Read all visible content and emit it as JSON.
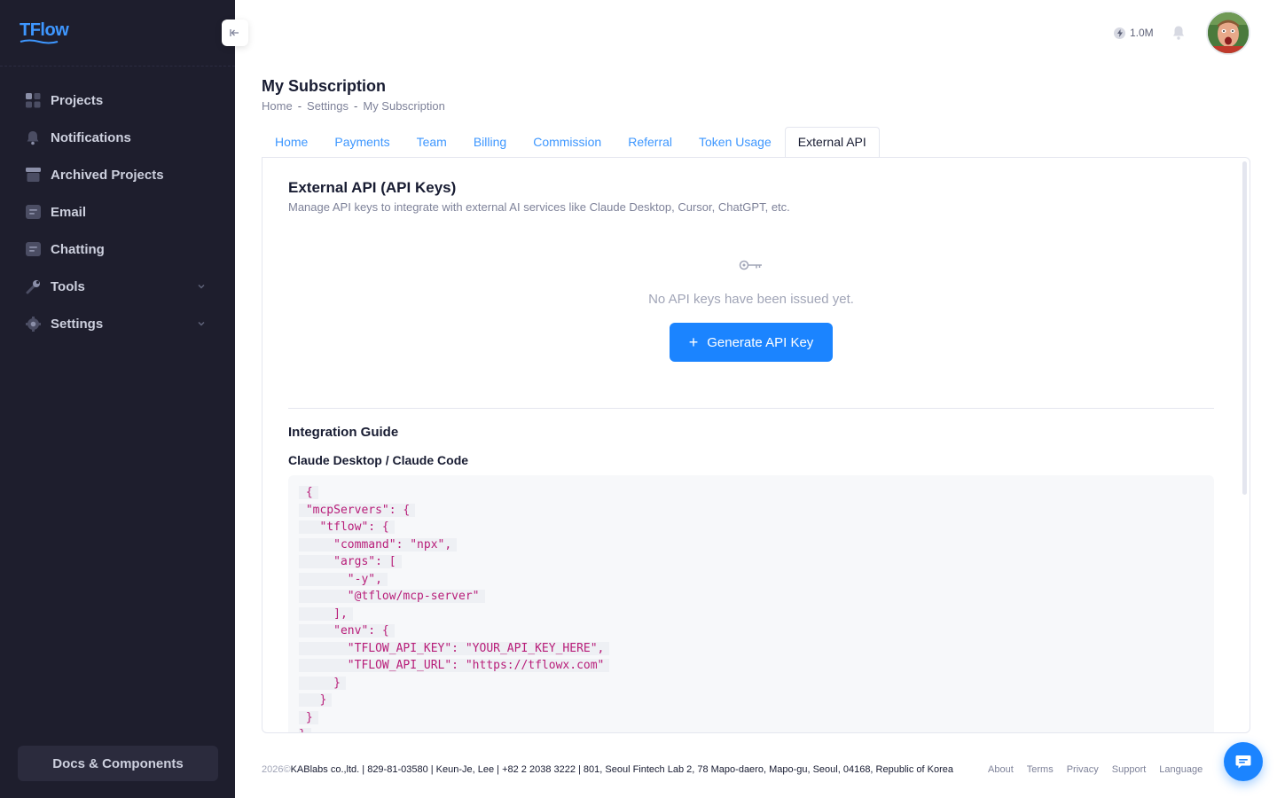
{
  "brand": {
    "name": "TFlow",
    "accent": "#1b84ff"
  },
  "sidebar": {
    "items": [
      {
        "label": "Projects",
        "icon": "grid-icon"
      },
      {
        "label": "Notifications",
        "icon": "bell-icon"
      },
      {
        "label": "Archived Projects",
        "icon": "archive-icon"
      },
      {
        "label": "Email",
        "icon": "message-icon"
      },
      {
        "label": "Chatting",
        "icon": "chat-icon"
      },
      {
        "label": "Tools",
        "icon": "wrench-icon",
        "expandable": true
      },
      {
        "label": "Settings",
        "icon": "gear-icon",
        "expandable": true
      }
    ],
    "docs_label": "Docs & Components"
  },
  "header": {
    "tokens": "1.0M"
  },
  "page": {
    "title": "My Subscription",
    "breadcrumb": [
      "Home",
      "Settings",
      "My Subscription"
    ]
  },
  "tabs": [
    "Home",
    "Payments",
    "Team",
    "Billing",
    "Commission",
    "Referral",
    "Token Usage",
    "External API"
  ],
  "active_tab": "External API",
  "card": {
    "title": "External API (API Keys)",
    "subtitle": "Manage API keys to integrate with external AI services like Claude Desktop, Cursor, ChatGPT, etc.",
    "empty_text": "No API keys have been issued yet.",
    "generate_label": "Generate API Key",
    "guide_title": "Integration Guide",
    "guide_subtitle": "Claude Desktop / Claude Code",
    "code_lines": [
      " {",
      " \"mcpServers\": {",
      "   \"tflow\": {",
      "     \"command\": \"npx\",",
      "     \"args\": [",
      "       \"-y\",",
      "       \"@tflow/mcp-server\"",
      "     ],",
      "     \"env\": {",
      "       \"TFLOW_API_KEY\": \"YOUR_API_KEY_HERE\",",
      "       \"TFLOW_API_URL\": \"https://tflowx.com\"",
      "     }",
      "   }",
      " }",
      "}"
    ]
  },
  "footer": {
    "year": "2026©",
    "company": " KABlabs co.,ltd. | 829-81-03580 | Keun-Je, Lee | +82 2 2038 3222 | 801, Seoul Fintech Lab 2, 78 Mapo-daero, Mapo-gu, Seoul, 04168, Republic of Korea",
    "links": [
      "About",
      "Terms",
      "Privacy",
      "Support",
      "Language"
    ]
  }
}
